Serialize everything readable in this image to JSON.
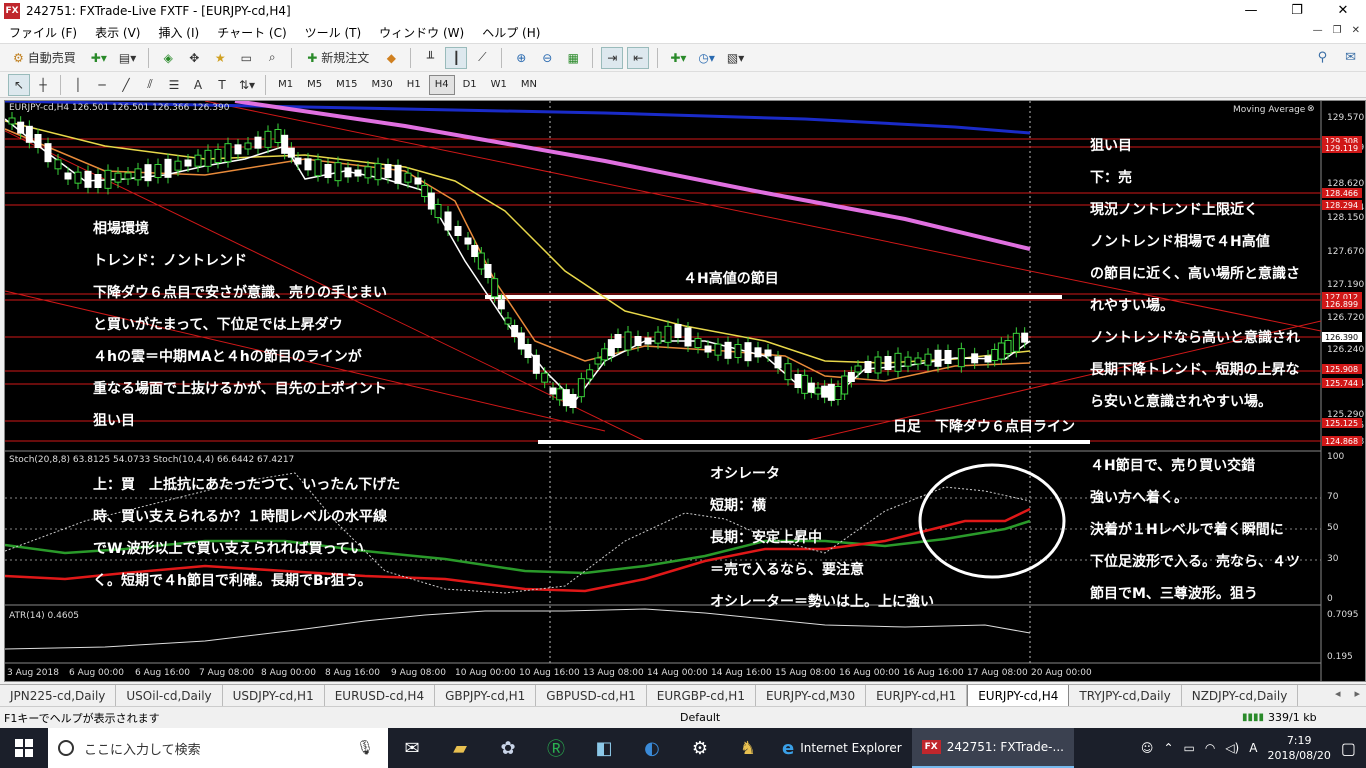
{
  "window": {
    "icon_label": "FX",
    "title": "242751: FXTrade-Live FXTF - [EURJPY-cd,H4]",
    "minimize": "—",
    "maximize": "❐",
    "close": "✕"
  },
  "menu": [
    "ファイル (F)",
    "表示 (V)",
    "挿入 (I)",
    "チャート (C)",
    "ツール (T)",
    "ウィンドウ (W)",
    "ヘルプ (H)"
  ],
  "toolbar": {
    "auto_trade": "自動売買",
    "new_order": "新規注文"
  },
  "timeframes": [
    "M1",
    "M5",
    "M15",
    "M30",
    "H1",
    "H4",
    "D1",
    "W1",
    "MN"
  ],
  "active_timeframe": "H4",
  "chart": {
    "header": "EURJPY-cd,H4  126.501 126.501 126.366 126.390",
    "indicator_label": "Moving Average",
    "stoch_label": "Stoch(20,8,8) 63.8125 54.0733  Stoch(10,4,4) 66.6442 67.4217",
    "atr_label": "ATR(14) 0.4605",
    "price_labels": [
      "129.570",
      "129.119",
      "128.620",
      "128.294",
      "128.150",
      "127.670",
      "127.190",
      "126.720",
      "126.240",
      "125.744",
      "125.290",
      "125.125",
      "124.868"
    ],
    "price_boxes": [
      "129.308",
      "129.119",
      "128.466",
      "128.294",
      "127.012",
      "126.899",
      "126.390",
      "125.908",
      "125.744",
      "125.125",
      "124.868"
    ],
    "stoch_levels": [
      "100",
      "70",
      "50",
      "30",
      "0"
    ],
    "atr_levels": [
      "0.7095",
      "0.195"
    ],
    "time_labels": [
      "3 Aug 2018",
      "6 Aug 00:00",
      "6 Aug 16:00",
      "7 Aug 08:00",
      "8 Aug 00:00",
      "8 Aug 16:00",
      "9 Aug 08:00",
      "10 Aug 00:00",
      "10 Aug 16:00",
      "13 Aug 08:00",
      "14 Aug 00:00",
      "14 Aug 16:00",
      "15 Aug 08:00",
      "16 Aug 00:00",
      "16 Aug 16:00",
      "17 Aug 08:00",
      "20 Aug 00:00"
    ]
  },
  "annotations": {
    "left_block": [
      "相場環境",
      "トレンド：ノントレンド",
      "下降ダウ６点目で安さが意識、売りの手じまい",
      "と買いがたまって、下位足では上昇ダウ",
      "４hの雲＝中期MAと４hの節目のラインが",
      "重なる場面で上抜けるかが、目先の上ポイント",
      "狙い目"
    ],
    "h4_level": "４H高値の節目",
    "daily_line": "日足　下降ダウ６点目ライン",
    "right_block": [
      "狙い目",
      "下：売",
      "現況ノントレンド上限近く",
      "ノントレンド相場で４H高値",
      "の節目に近く、高い場所と意識さ",
      "れやすい場。",
      "ノントレンドなら高いと意識され",
      "長期下降トレンド、短期の上昇な",
      "ら安いと意識されやすい場。"
    ],
    "stoch_left": [
      "上：買　上抵抗にあたったつて、いったん下げた",
      "時、買い支えられるか？１時間レベルの水平線",
      "でW,波形以上で買い支えられれば買ってい",
      "く。短期で４h節目で利確。長期でBr狙う。"
    ],
    "oscillator": [
      "オシレータ",
      "短期：横",
      "長期：安定上昇中",
      "＝売で入るなら、要注意",
      "オシレーター＝勢いは上。上に強い"
    ],
    "right_lower": [
      "４H節目で、売り買い交錯",
      "強い方へ着く。",
      "決着が１Hレベルで着く瞬間に",
      "下位足波形で入る。売なら、４ツ",
      "節目でM、三尊波形。狙う"
    ]
  },
  "tabs": [
    "JPN225-cd,Daily",
    "USOil-cd,Daily",
    "USDJPY-cd,H1",
    "EURUSD-cd,H4",
    "GBPJPY-cd,H1",
    "GBPUSD-cd,H1",
    "EURGBP-cd,H1",
    "EURJPY-cd,M30",
    "EURJPY-cd,H1",
    "EURJPY-cd,H4",
    "TRYJPY-cd,Daily",
    "NZDJPY-cd,Daily"
  ],
  "active_tab": "EURJPY-cd,H4",
  "status": {
    "help": "F1キーでヘルプが表示されます",
    "profile": "Default",
    "traffic": "339/1 kb"
  },
  "taskbar": {
    "search_placeholder": "ここに入力して検索",
    "ie_label": "Internet Explorer",
    "mt4_label": "242751: FXTrade-...",
    "ime": "A",
    "time": "7:19",
    "date": "2018/08/20"
  },
  "colors": {
    "chart_bg": "#000000",
    "ma_blue": "#1a2bc8",
    "ma_pink": "#e070e0",
    "ma_yellow": "#e8d84a",
    "ma_orange": "#e88a3a",
    "red_lines": "#d01818",
    "stoch_red": "#e01818",
    "stoch_green": "#2a9a2a"
  }
}
